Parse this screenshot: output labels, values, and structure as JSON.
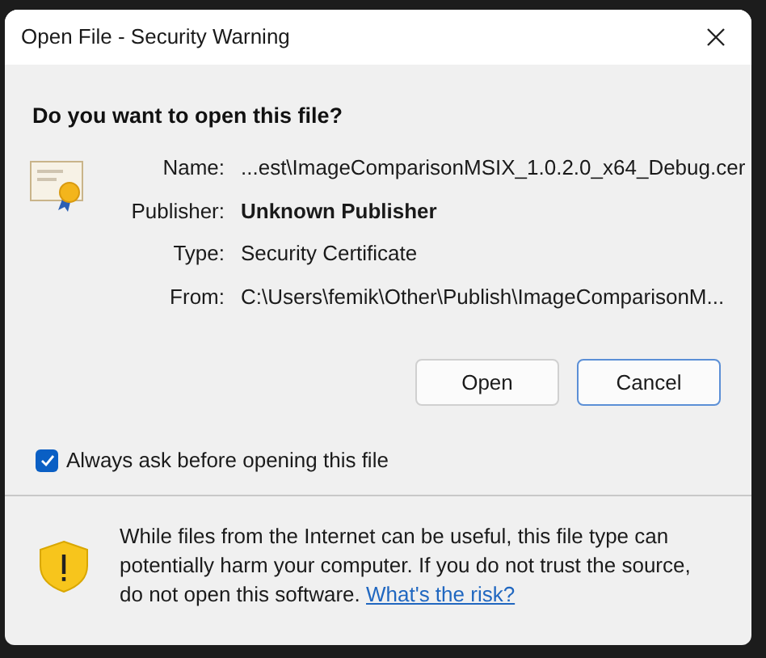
{
  "window": {
    "title": "Open File - Security Warning"
  },
  "question": "Do you want to open this file?",
  "fields": [
    {
      "label": "Name:",
      "value": "...est\\ImageComparisonMSIX_1.0.2.0_x64_Debug.cer",
      "kind": "plain"
    },
    {
      "label": "Publisher:",
      "value": "Unknown Publisher",
      "kind": "strong"
    },
    {
      "label": "Type:",
      "value": "Security Certificate",
      "kind": "plain"
    },
    {
      "label": "From:",
      "value": "C:\\Users\\femik\\Other\\Publish\\ImageComparisonM...",
      "kind": "plain"
    }
  ],
  "buttons": [
    {
      "label": "Open",
      "focused": false
    },
    {
      "label": "Cancel",
      "focused": true
    }
  ],
  "checkbox": {
    "label": "Always ask before opening this file",
    "checked": true
  },
  "warning": {
    "text": "While files from the Internet can be useful, this file type can potentially harm your computer. If you do not trust the source, do not open this software.",
    "link": "What's the risk?"
  }
}
